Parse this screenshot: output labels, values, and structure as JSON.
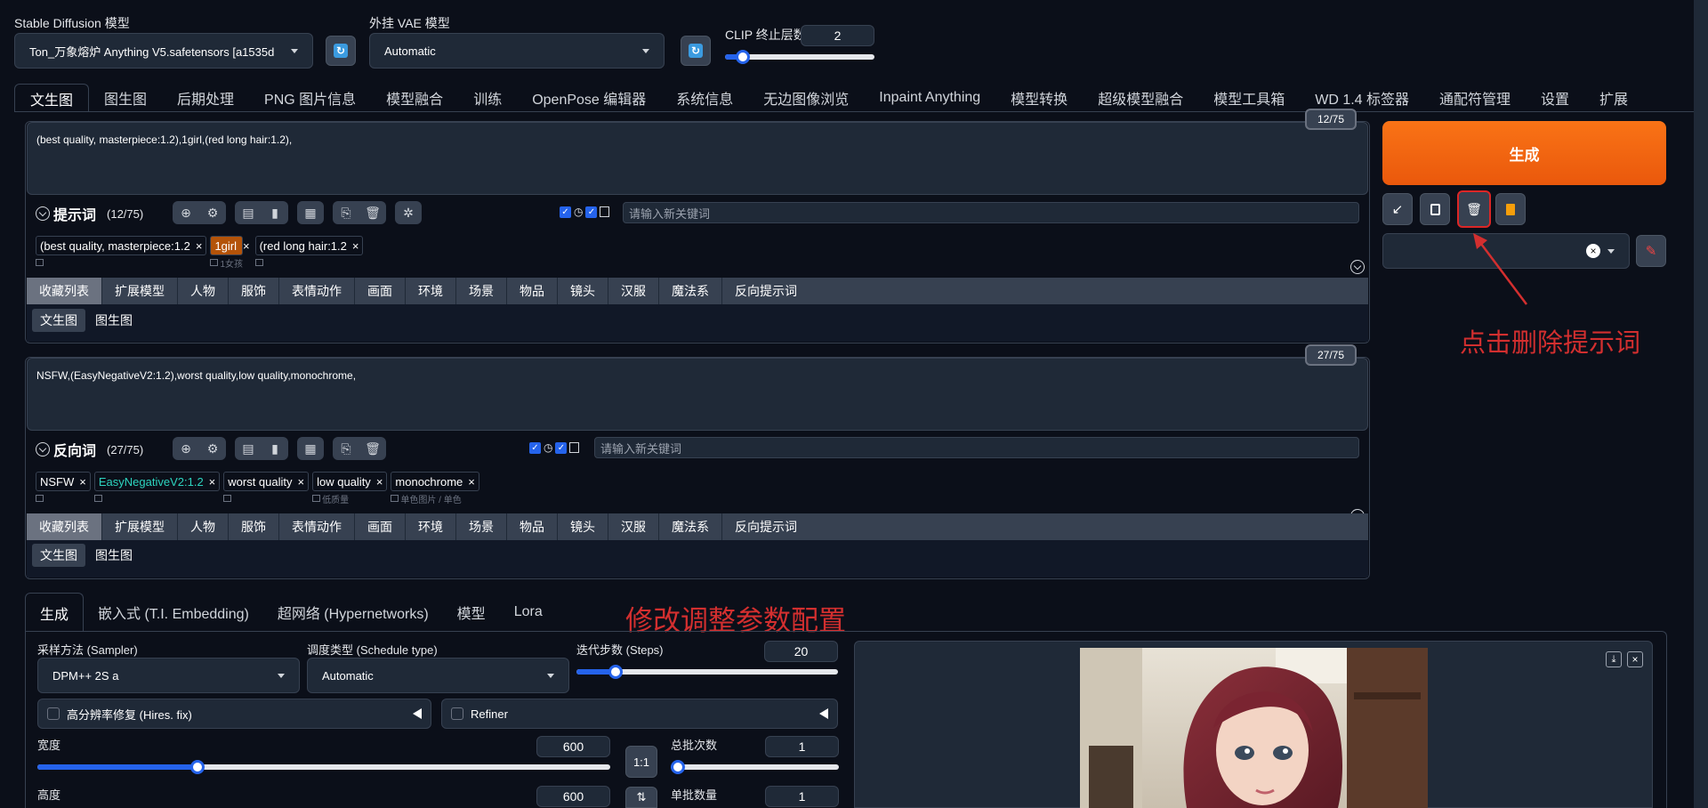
{
  "top": {
    "sd_model_label": "Stable Diffusion 模型",
    "sd_model_value": "Ton_万象熔炉 Anything V5.safetensors [a1535d",
    "vae_label": "外挂 VAE 模型",
    "vae_value": "Automatic",
    "clip_label": "CLIP 终止层数",
    "clip_value": "2"
  },
  "main_tabs": [
    "文生图",
    "图生图",
    "后期处理",
    "PNG 图片信息",
    "模型融合",
    "训练",
    "OpenPose 编辑器",
    "系统信息",
    "无边图像浏览",
    "Inpaint Anything",
    "模型转换",
    "超级模型融合",
    "模型工具箱",
    "WD 1.4 标签器",
    "通配符管理",
    "设置",
    "扩展"
  ],
  "prompt": {
    "text": "(best quality, masterpiece:1.2),1girl,(red long hair:1.2),",
    "counter": "12/75",
    "title": "提示词",
    "count": "(12/75)",
    "kw_placeholder": "请输入新关键词",
    "tags": [
      {
        "text": "(best quality, masterpiece:1.2",
        "sub": ""
      },
      {
        "text": "1girl",
        "sub": "1女孩"
      },
      {
        "text": "(red long hair:1.2",
        "sub": ""
      }
    ]
  },
  "negative": {
    "text": "NSFW,(EasyNegativeV2:1.2),worst quality,low quality,monochrome,",
    "counter": "27/75",
    "title": "反向词",
    "count": "(27/75)",
    "kw_placeholder": "请输入新关键词",
    "tags": [
      {
        "text": "NSFW",
        "sub": ""
      },
      {
        "text": "EasyNegativeV2:1.2",
        "sub": ""
      },
      {
        "text": "worst quality",
        "sub": ""
      },
      {
        "text": "low quality",
        "sub": "低质量"
      },
      {
        "text": "monochrome",
        "sub": "单色图片 / 单色"
      }
    ]
  },
  "categories": [
    "收藏列表",
    "扩展模型",
    "人物",
    "服饰",
    "表情动作",
    "画面",
    "环境",
    "场景",
    "物品",
    "镜头",
    "汉服",
    "魔法系",
    "反向提示词"
  ],
  "sub_tabs": [
    "文生图",
    "图生图"
  ],
  "right": {
    "generate": "生成",
    "annotation_delete": "点击删除提示词"
  },
  "annotation_params": "修改调整参数配置",
  "param_tabs": [
    "生成",
    "嵌入式 (T.I. Embedding)",
    "超网络 (Hypernetworks)",
    "模型",
    "Lora"
  ],
  "params": {
    "sampler_label": "采样方法 (Sampler)",
    "sampler_value": "DPM++ 2S a",
    "schedule_label": "调度类型 (Schedule type)",
    "schedule_value": "Automatic",
    "steps_label": "迭代步数 (Steps)",
    "steps_value": "20",
    "hires_label": "高分辨率修复 (Hires. fix)",
    "refiner_label": "Refiner",
    "width_label": "宽度",
    "width_value": "600",
    "height_label": "高度",
    "height_value": "600",
    "ratio_label": "1:1",
    "batch_count_label": "总批次数",
    "batch_count_value": "1",
    "batch_size_label": "单批数量",
    "batch_size_value": "1"
  }
}
